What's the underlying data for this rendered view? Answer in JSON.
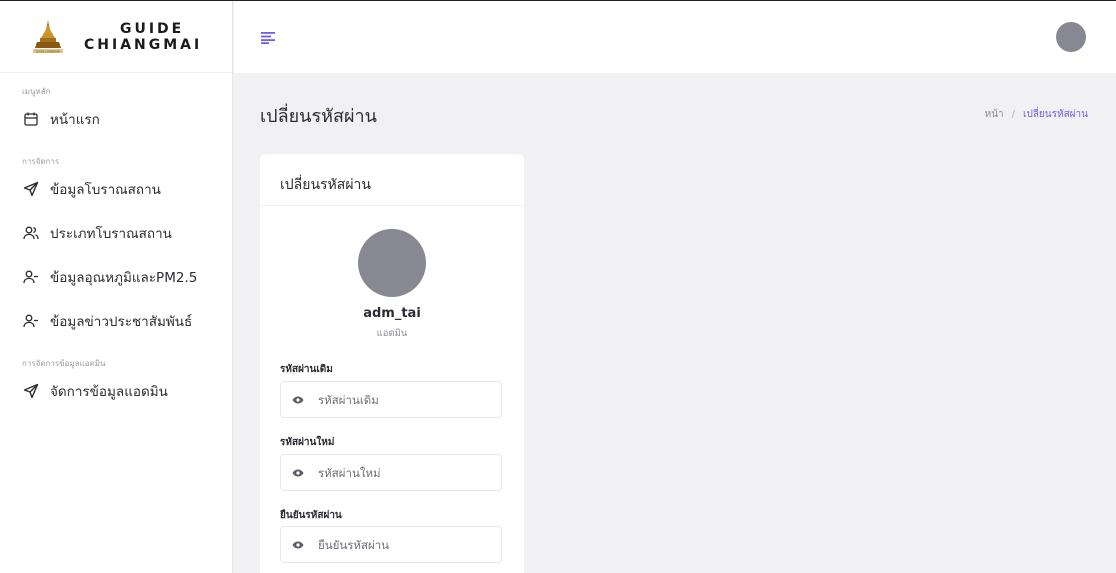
{
  "brand": {
    "line1": "GUIDE",
    "line2": "CHIANGMAI",
    "logo_text": "GUIDE CHIANGMAI"
  },
  "sidebar": {
    "sections": [
      {
        "title": "เมนูหลัก",
        "items": [
          {
            "label": "หน้าแรก",
            "icon": "calendar-icon"
          }
        ]
      },
      {
        "title": "การจัดการ",
        "items": [
          {
            "label": "ข้อมูลโบราณสถาน",
            "icon": "send-icon"
          },
          {
            "label": "ประเภทโบราณสถาน",
            "icon": "users-icon"
          },
          {
            "label": "ข้อมูลอุณหภูมิและPM2.5",
            "icon": "user-minus-icon"
          },
          {
            "label": "ข้อมูลข่าวประชาสัมพันธ์",
            "icon": "user-minus-icon"
          }
        ]
      },
      {
        "title": "การจัดการข้อมูลแอดมิน",
        "items": [
          {
            "label": "จัดการข้อมูลแอดมิน",
            "icon": "send-icon"
          }
        ]
      }
    ]
  },
  "header": {
    "menu_icon": "menu-icon"
  },
  "page": {
    "title": "เปลี่ยนรหัสผ่าน",
    "breadcrumb": {
      "home": "หน้า",
      "separator": "/",
      "current": "เปลี่ยนรหัสผ่าน"
    }
  },
  "card": {
    "title": "เปลี่ยนรหัสผ่าน",
    "username": "adm_tai",
    "role": "แอดมิน",
    "fields": [
      {
        "label": "รหัสผ่านเดิม",
        "placeholder": "รหัสผ่านเดิม",
        "value": ""
      },
      {
        "label": "รหัสผ่านใหม่",
        "placeholder": "รหัสผ่านใหม่",
        "value": ""
      },
      {
        "label": "ยืนยันรหัสผ่าน",
        "placeholder": "ยืนยันรหัสผ่าน",
        "value": ""
      }
    ]
  },
  "colors": {
    "accent": "#6f5cf0",
    "avatar": "#888893",
    "background": "#f1f1f3"
  }
}
